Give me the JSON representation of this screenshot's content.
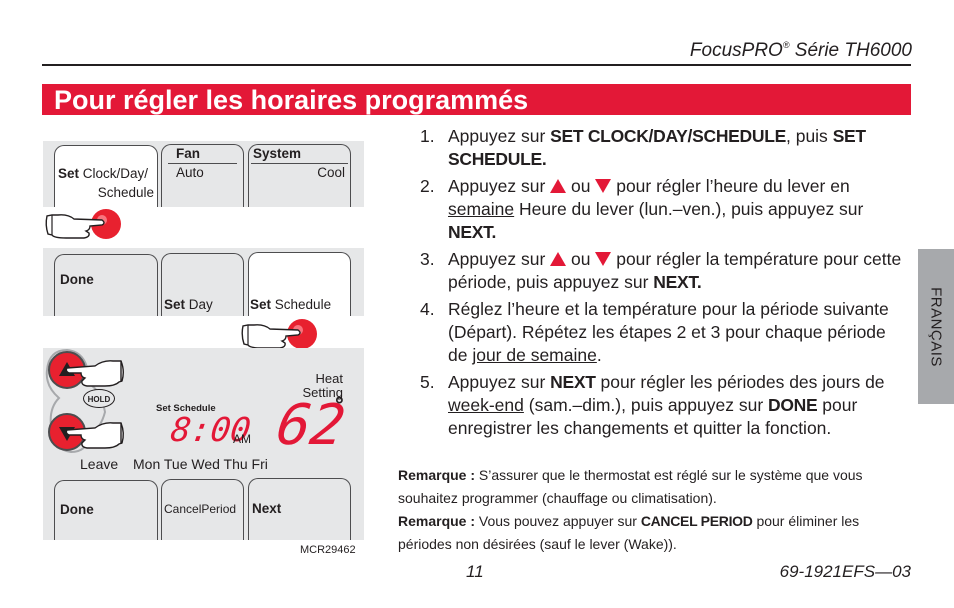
{
  "header": {
    "product": "FocusPRO",
    "registered_mark": "®",
    "series": "Série TH6000"
  },
  "section_title": "Pour régler les horaires programmés",
  "side_tab": "FRANÇAIS",
  "panel1": {
    "tabs": [
      {
        "bold": "Set",
        "text": "Clock/Day/",
        "text2": "Schedule"
      },
      {
        "header": "Fan",
        "value": "Auto"
      },
      {
        "header": "System",
        "value": "Cool"
      }
    ]
  },
  "panel2": {
    "tabs": [
      {
        "bold": "Done"
      },
      {
        "bold": "Set",
        "text": "Day"
      },
      {
        "bold": "Set",
        "text": "Schedule"
      }
    ]
  },
  "panel3": {
    "hold_label": "HOLD",
    "mode_label": "Set Schedule",
    "time": "8:00",
    "ampm": "AM",
    "heat_label": "Heat",
    "setting_label": "Setting",
    "temperature": "62",
    "degree": "°",
    "period": "Leave",
    "days": "Mon Tue Wed Thu Fri"
  },
  "panel4": {
    "tabs": [
      {
        "bold": "Done"
      },
      {
        "text": "CancelPeriod"
      },
      {
        "bold": "Next"
      }
    ]
  },
  "figure_id": "MCR29462",
  "steps": [
    {
      "num": "1.",
      "a": "Appuyez sur ",
      "k1": "SET CLOCK/DAY/SCHEDULE",
      "b": ", puis ",
      "k2": "SET SCHEDULE",
      "c": "."
    },
    {
      "num": "2.",
      "a": "Appuyez sur ",
      "or": " ou ",
      "b": " pour régler l’heure du lever en ",
      "u": "semaine",
      "c": " Heure du lever (lun.–ven.), puis appuyez sur ",
      "k": "NEXT",
      "d": "."
    },
    {
      "num": "3.",
      "a": "Appuyez sur ",
      "or": " ou ",
      "b": " pour régler la température pour cette période, puis appuyez sur ",
      "k": "NEXT",
      "c": "."
    },
    {
      "num": "4.",
      "a": "Réglez l’heure et la température pour la période suivante (Départ). Répétez les étapes 2 et 3 pour chaque période de ",
      "u": "jour de semaine",
      "b": "."
    },
    {
      "num": "5.",
      "a": "Appuyez sur ",
      "k1": "NEXT",
      "b": " pour régler les périodes des jours de ",
      "u": "week-end",
      "c": " (sam.–dim.), puis appuyez sur ",
      "k2": "DONE",
      "d": " pour enregistrer les changements et quitter la fonction."
    }
  ],
  "notes": [
    {
      "label": "Remarque :",
      "a": " S’assurer que le thermostat est réglé sur le système que vous souhaitez programmer (chauffage ou climatisation)."
    },
    {
      "label": "Remarque :",
      "a": " Vous pouvez appuyer sur ",
      "k": "CANCEL PERIOD",
      "b": " pour éliminer les périodes non désirées (sauf le lever (Wake))."
    }
  ],
  "footer": {
    "page_number": "11",
    "doc_number": "69-1921EFS—03"
  },
  "colors": {
    "accent_red": "#e31837",
    "panel_gray": "#e6e7e8",
    "side_tab_gray": "#a7a9ac"
  }
}
